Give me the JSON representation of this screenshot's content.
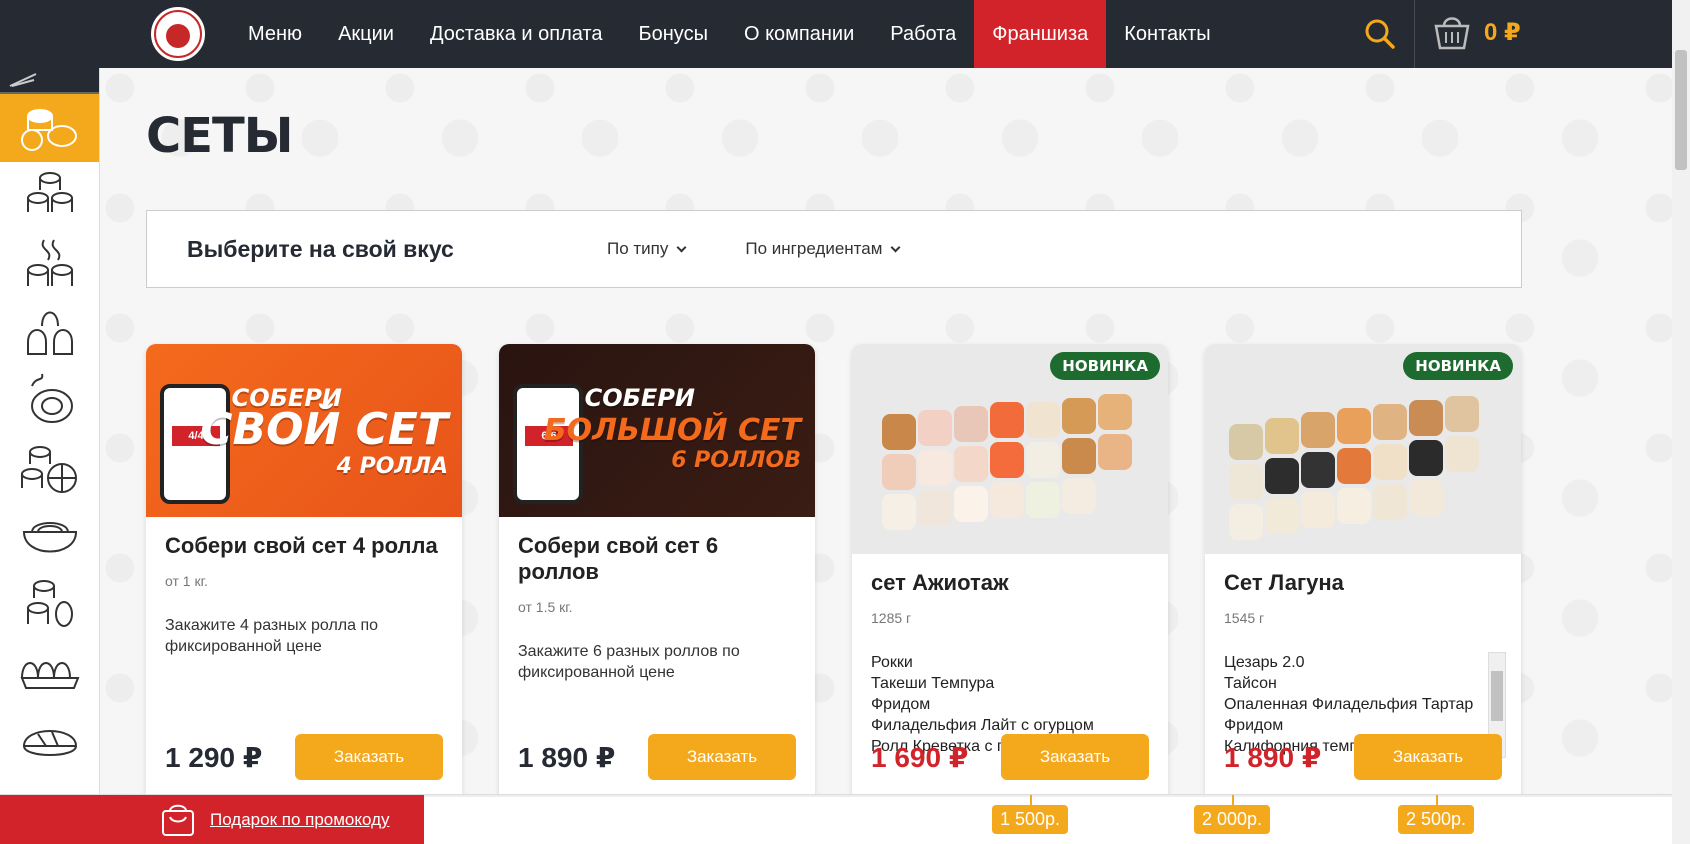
{
  "nav": {
    "items": [
      {
        "label": "Меню"
      },
      {
        "label": "Акции"
      },
      {
        "label": "Доставка и оплата"
      },
      {
        "label": "Бонусы"
      },
      {
        "label": "О компании"
      },
      {
        "label": "Работа"
      },
      {
        "label": "Франшиза"
      },
      {
        "label": "Контакты"
      }
    ],
    "active_index": 6,
    "cart_total": "0 ₽",
    "accent_color": "#f4a81c",
    "active_color": "#d3232a"
  },
  "sidebar": {
    "items": [
      {
        "icon": "sets-icon",
        "active": true
      },
      {
        "icon": "rolls-icon"
      },
      {
        "icon": "baked-rolls-icon"
      },
      {
        "icon": "gunkan-icon"
      },
      {
        "icon": "tempura-icon"
      },
      {
        "icon": "mini-rolls-icon"
      },
      {
        "icon": "noodles-icon"
      },
      {
        "icon": "combo-rolls-icon"
      },
      {
        "icon": "big-rolls-icon"
      },
      {
        "icon": "sushi-icon"
      }
    ]
  },
  "page": {
    "title": "Сеты"
  },
  "filter": {
    "title": "Выберите на свой вкус",
    "by_type": "По типу",
    "by_ingredients": "По ингредиентам"
  },
  "cards": [
    {
      "promo_line1": "СОБЕРИ",
      "promo_line2": "СВОЙ СЕТ",
      "promo_line3": "4 РОЛЛА",
      "phone_count": "4/4",
      "title": "Собери свой сет 4 ролла",
      "weight": "от 1 кг.",
      "desc": "Закажите 4 разных ролла по фиксированной цене",
      "price": "1 290 ₽",
      "button": "Заказать"
    },
    {
      "promo_line1": "СОБЕРИ",
      "promo_line2": "БОЛЬШОЙ СЕТ",
      "promo_line3": "6 РОЛЛОВ",
      "phone_count": "6/6",
      "title": "Собери свой сет 6 роллов",
      "weight": "от 1.5 кг.",
      "desc": "Закажите 6 разных роллов по фиксированной цене",
      "price": "1 890 ₽",
      "button": "Заказать"
    },
    {
      "badge": "НОВИНКА",
      "title": "сет Ажиотаж",
      "weight": "1285 г",
      "ingredients": [
        "Рокки",
        "Такеши Темпура",
        "Фридом",
        "Филадельфия Лайт с огурцом",
        "Ролл Креветка с грушей"
      ],
      "price": "1 690 ₽",
      "button": "Заказать"
    },
    {
      "badge": "НОВИНКА",
      "title": "Сет Лагуна",
      "weight": "1545 г",
      "ingredients": [
        "Цезарь 2.0",
        "Тайсон",
        "Опаленная Филадельфия Тартар",
        "Фридом",
        "Калифорния темпура"
      ],
      "price": "1 890 ₽",
      "button": "Заказать"
    }
  ],
  "bottom": {
    "promo_link": "Подарок по промокоду",
    "milestones": [
      "1 500р.",
      "2 000р.",
      "2 500р."
    ]
  }
}
